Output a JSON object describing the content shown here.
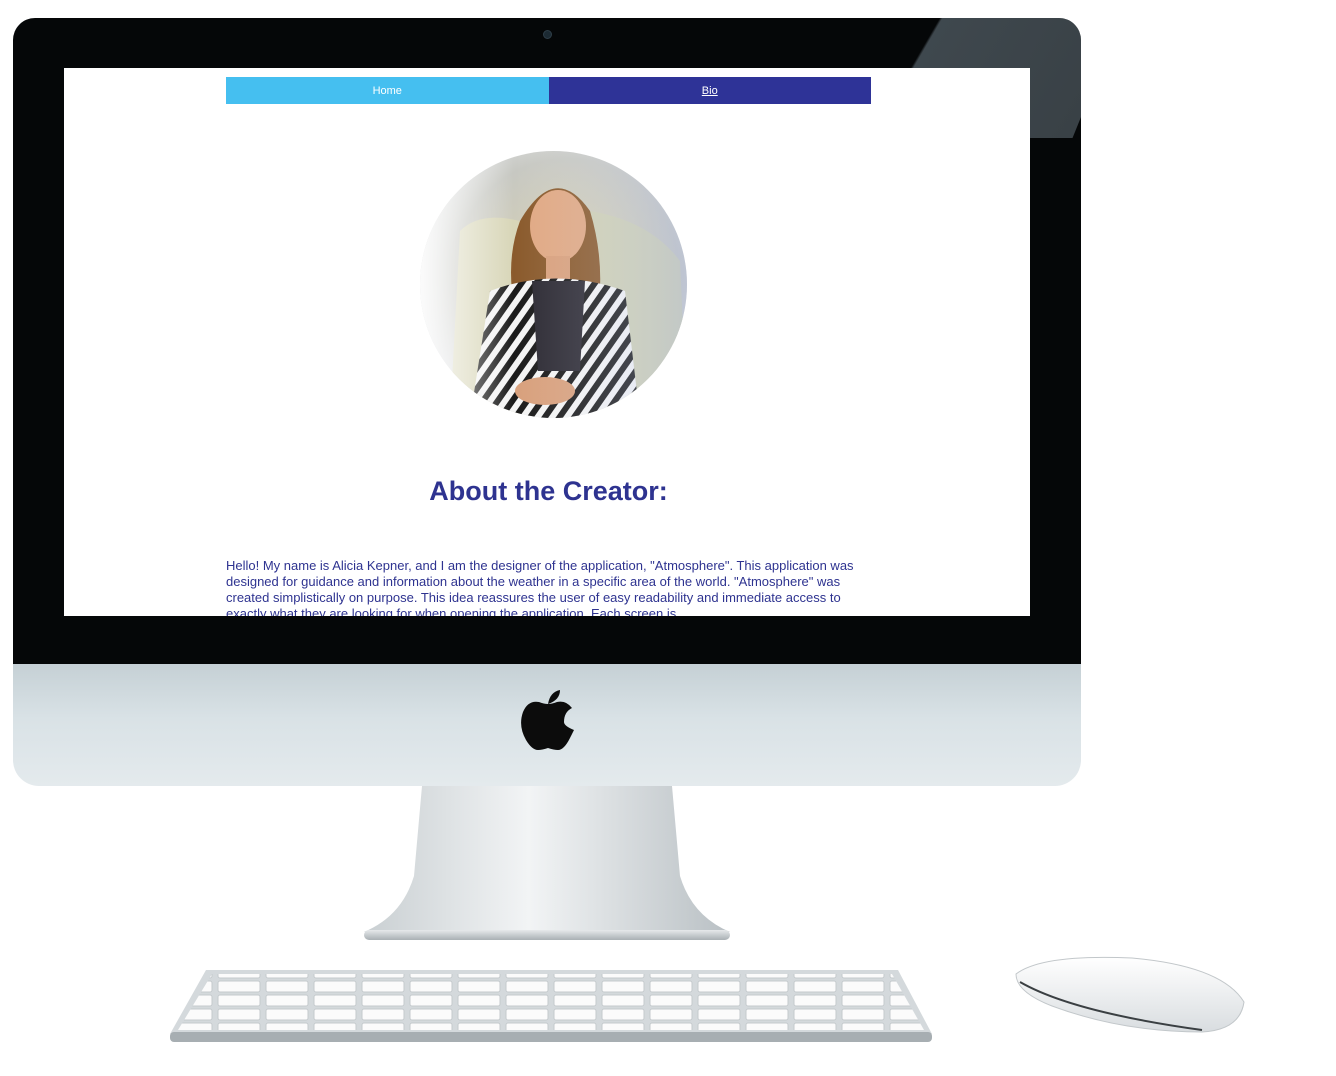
{
  "nav": {
    "home_label": "Home",
    "bio_label": "Bio"
  },
  "bio": {
    "heading": "About the Creator:",
    "paragraph": "Hello! My name is Alicia Kepner, and I am the designer of the application, \"Atmosphere\". This application was designed for guidance and information about the weather in a specific area of the world. \"Atmosphere\" was created simplistically on purpose. This idea reassures the user of easy readability and immediate access to exactly what they are looking for when opening the application. Each screen is"
  },
  "colors": {
    "home_tab": "#45bff0",
    "bio_tab": "#2e3397",
    "text": "#2e3390"
  },
  "icons": {
    "brand_logo": "apple-logo-icon"
  }
}
